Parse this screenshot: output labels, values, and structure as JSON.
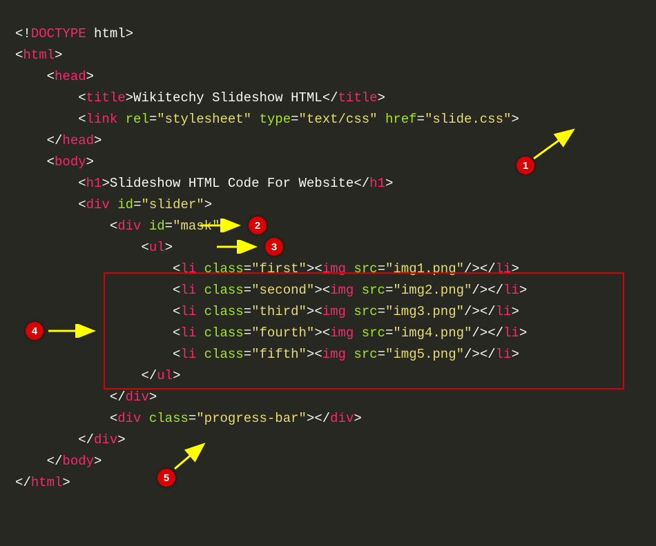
{
  "code": {
    "doctype_open": "<!",
    "doctype_name": "DOCTYPE",
    "doctype_arg": " html",
    "doctype_close": ">",
    "html_tag": "html",
    "head_tag": "head",
    "title_tag": "title",
    "title_text": "Wikitechy Slideshow HTML",
    "link_tag": "link",
    "rel_attr": "rel",
    "rel_val": "\"stylesheet\"",
    "type_attr": "type",
    "type_val": "\"text/css\"",
    "href_attr": "href",
    "href_val": "\"slide.css\"",
    "body_tag": "body",
    "h1_tag": "h1",
    "h1_text": "Slideshow HTML Code For Website",
    "div_tag": "div",
    "id_attr": "id",
    "slider_val": "\"slider\"",
    "mask_val": "\"mask\"",
    "ul_tag": "ul",
    "li_tag": "li",
    "class_attr": "class",
    "img_tag": "img",
    "src_attr": "src",
    "li1_class": "\"first\"",
    "li1_src": "\"img1.png\"",
    "li2_class": "\"second\"",
    "li2_src": "\"img2.png\"",
    "li3_class": "\"third\"",
    "li3_src": "\"img3.png\"",
    "li4_class": "\"fourth\"",
    "li4_src": "\"img4.png\"",
    "li5_class": "\"fifth\"",
    "li5_src": "\"img5.png\"",
    "pb_val": "\"progress-bar\""
  },
  "badges": {
    "b1": "1",
    "b2": "2",
    "b3": "3",
    "b4": "4",
    "b5": "5"
  }
}
